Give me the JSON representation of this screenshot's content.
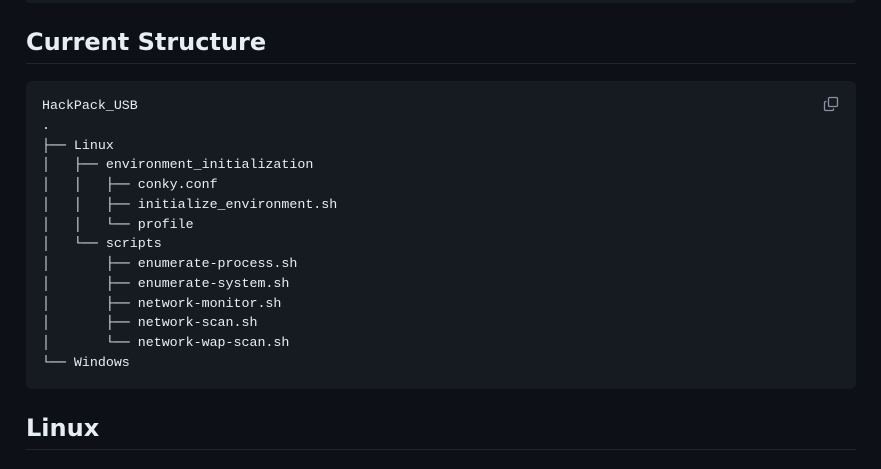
{
  "headings": {
    "current_structure": "Current Structure",
    "linux": "Linux"
  },
  "code_block": {
    "copy_icon": "copy-icon",
    "lines": [
      "HackPack_USB",
      ".",
      "├── Linux",
      "│   ├── environment_initialization",
      "│   │   ├── conky.conf",
      "│   │   ├── initialize_environment.sh",
      "│   │   └── profile",
      "│   └── scripts",
      "│       ├── enumerate-process.sh",
      "│       ├── enumerate-system.sh",
      "│       ├── network-monitor.sh",
      "│       ├── network-scan.sh",
      "│       └── network-wap-scan.sh",
      "└── Windows"
    ]
  },
  "colors": {
    "background": "#0d1117",
    "code_background": "#161b22",
    "text": "#e6edf3",
    "border": "#21262d",
    "icon": "#8b949e"
  }
}
